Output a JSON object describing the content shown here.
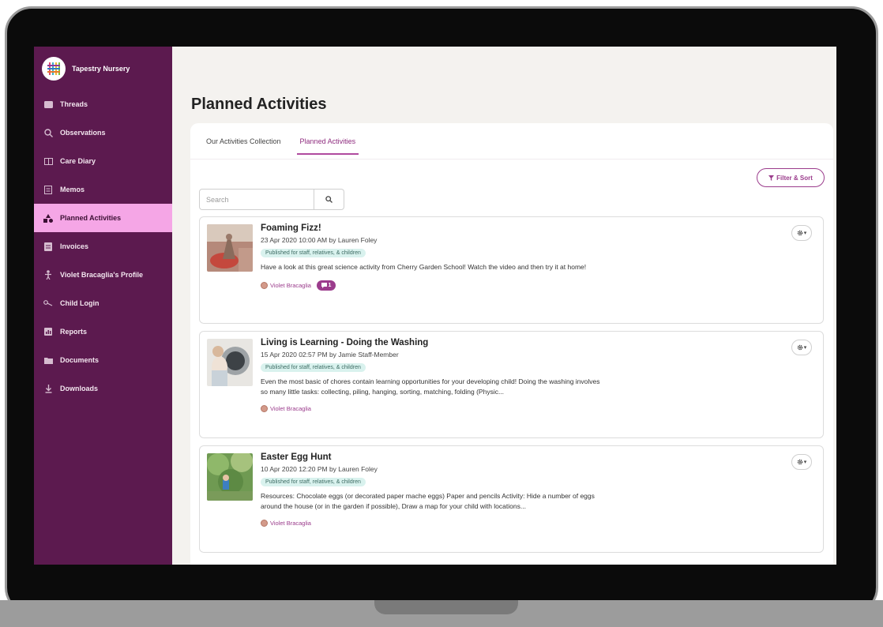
{
  "sidebar": {
    "brand": "Tapestry Nursery",
    "items": [
      {
        "label": "Threads",
        "icon": "threads-icon"
      },
      {
        "label": "Observations",
        "icon": "observations-icon"
      },
      {
        "label": "Care Diary",
        "icon": "care-diary-icon"
      },
      {
        "label": "Memos",
        "icon": "memos-icon"
      },
      {
        "label": "Planned Activities",
        "icon": "planned-activities-icon",
        "active": true
      },
      {
        "label": "Invoices",
        "icon": "invoices-icon"
      },
      {
        "label": "Violet Bracaglia's Profile",
        "icon": "profile-icon"
      },
      {
        "label": "Child Login",
        "icon": "key-icon"
      },
      {
        "label": "Reports",
        "icon": "reports-icon"
      },
      {
        "label": "Documents",
        "icon": "folder-icon"
      },
      {
        "label": "Downloads",
        "icon": "download-icon"
      }
    ]
  },
  "main": {
    "title": "Planned Activities",
    "tabs": [
      {
        "label": "Our Activities Collection"
      },
      {
        "label": "Planned Activities",
        "active": true
      }
    ],
    "filter_label": "Filter & Sort",
    "search": {
      "placeholder": "Search",
      "value": ""
    },
    "activities": [
      {
        "title": "Foaming Fizz!",
        "meta": "23 Apr 2020 10:00 AM by Lauren Foley",
        "badge": "Published for staff, relatives, & children",
        "description": "Have a look at this great science activity from Cherry Garden School! Watch the video and then try it at home!",
        "child": "Violet Bracaglia",
        "comments": "1"
      },
      {
        "title": "Living is Learning - Doing the Washing",
        "meta": "15 Apr 2020 02:57 PM by Jamie Staff-Member",
        "badge": "Published for staff, relatives, & children",
        "description": "Even the most basic of chores contain learning opportunities for your developing child! Doing the washing involves so many little tasks: collecting, piling, hanging, sorting, matching, folding (Physic...",
        "child": "Violet Bracaglia"
      },
      {
        "title": "Easter Egg Hunt",
        "meta": "10 Apr 2020 12:20 PM by Lauren Foley",
        "badge": "Published for staff, relatives, & children",
        "description": "Resources: Chocolate eggs (or decorated paper mache eggs) Paper and pencils Activity: Hide a number of eggs around the house (or in the garden if possible), Draw a map for your child with locations...",
        "child": "Violet Bracaglia"
      }
    ]
  },
  "colors": {
    "sidebar_bg": "#5c1a4f",
    "active_nav": "#f5a6e6",
    "accent": "#9b3c8c",
    "badge_bg": "#d9f2ee"
  }
}
